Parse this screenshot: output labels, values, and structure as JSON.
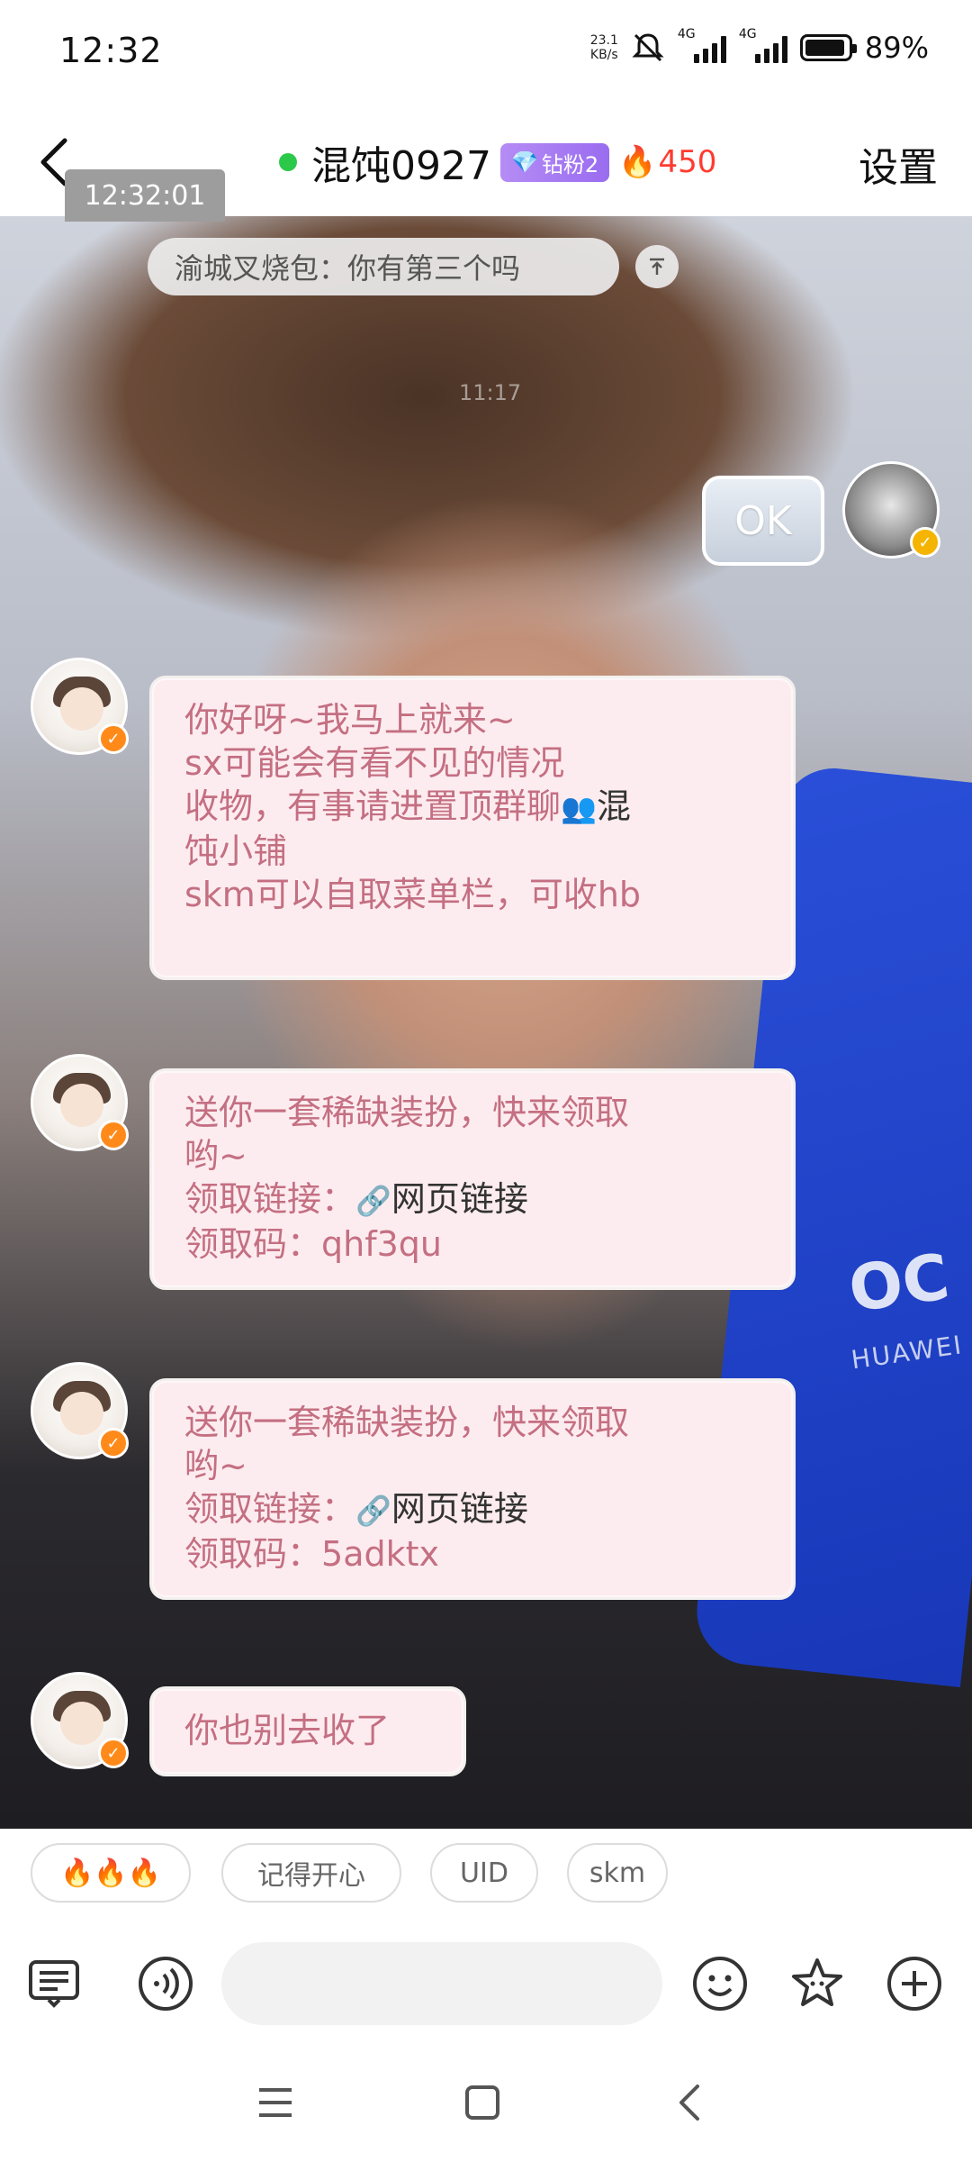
{
  "status_bar": {
    "time": "12:32",
    "net_speed_value": "23.1",
    "net_speed_unit": "KB/s",
    "signal1_label": "4G",
    "signal2_label": "4G",
    "battery": "89%",
    "icons": [
      "mute-icon",
      "signal-icon",
      "battery-icon"
    ]
  },
  "header": {
    "back_icon": "‹",
    "title": "混饨0927",
    "fan_badge": "钻粉2",
    "fire_count": "450",
    "settings": "设置",
    "time_chip": "12:32:01"
  },
  "chat": {
    "pinned_banner": "渝城叉烧包：你有第三个吗",
    "message_time": "11:17",
    "self_message": "OK",
    "messages": [
      {
        "lines": [
          "你好呀~我马上就来~",
          "sx可能会有看不见的情况",
          "收物，有事请进置顶群聊",
          "饨小铺",
          "skm可以自取菜单栏，可收hb"
        ],
        "group_link": "混"
      },
      {
        "lines": [
          "送你一套稀缺装扮，快来领取",
          "哟~"
        ],
        "link_prefix": "领取链接：",
        "link_text": "网页链接",
        "code_prefix": "领取码：",
        "code": "qhf3qu"
      },
      {
        "lines": [
          "送你一套稀缺装扮，快来领取",
          "哟~"
        ],
        "link_prefix": "领取链接：",
        "link_text": "网页链接",
        "code_prefix": "领取码：",
        "code": "5adktx"
      },
      {
        "lines": [
          "你也别去收了"
        ]
      }
    ]
  },
  "background": {
    "phone_brand": "HUAWEI",
    "phone_logo": "OC"
  },
  "quick_replies": [
    "🔥🔥🔥",
    "记得开心",
    "UID",
    "skm"
  ],
  "input_bar": {
    "icons": [
      "keyboard-icon",
      "voice-icon",
      "emoji-icon",
      "sticker-icon",
      "plus-icon"
    ]
  },
  "nav": {
    "icons": [
      "menu-icon",
      "home-icon",
      "back-icon"
    ]
  }
}
